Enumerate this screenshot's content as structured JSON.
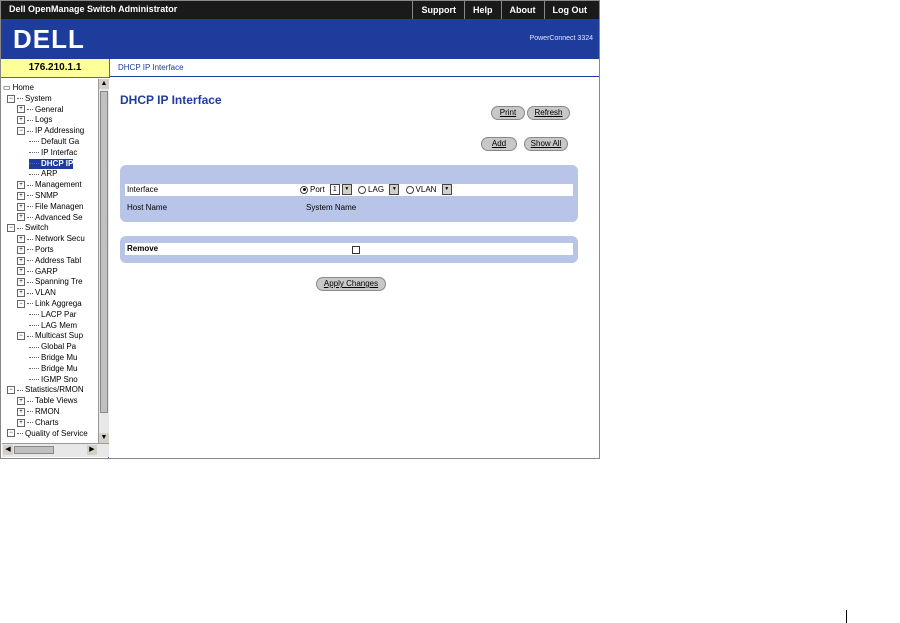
{
  "app": {
    "title": "Dell OpenManage Switch Administrator",
    "product": "PowerConnect 3324",
    "logo": "DELL"
  },
  "top_links": [
    "Support",
    "Help",
    "About",
    "Log Out"
  ],
  "ip_address": "176.210.1.1",
  "breadcrumb": "DHCP IP Interface",
  "tree": [
    {
      "label": "Home",
      "level": 0,
      "type": "home"
    },
    {
      "label": "System",
      "level": 1,
      "type": "minus"
    },
    {
      "label": "General",
      "level": 2,
      "type": "plus"
    },
    {
      "label": "Logs",
      "level": 2,
      "type": "plus"
    },
    {
      "label": "IP Addressing",
      "level": 2,
      "type": "minus"
    },
    {
      "label": "Default Ga",
      "level": 3,
      "type": "leaf"
    },
    {
      "label": "IP Interfac",
      "level": 3,
      "type": "leaf"
    },
    {
      "label": "DHCP IP",
      "level": 3,
      "type": "leaf",
      "selected": true
    },
    {
      "label": "ARP",
      "level": 3,
      "type": "leaf"
    },
    {
      "label": "Management",
      "level": 2,
      "type": "plus"
    },
    {
      "label": "SNMP",
      "level": 2,
      "type": "plus"
    },
    {
      "label": "File Managen",
      "level": 2,
      "type": "plus"
    },
    {
      "label": "Advanced Se",
      "level": 2,
      "type": "plus"
    },
    {
      "label": "Switch",
      "level": 1,
      "type": "minus"
    },
    {
      "label": "Network Secu",
      "level": 2,
      "type": "plus"
    },
    {
      "label": "Ports",
      "level": 2,
      "type": "plus"
    },
    {
      "label": "Address Tabl",
      "level": 2,
      "type": "plus"
    },
    {
      "label": "GARP",
      "level": 2,
      "type": "plus"
    },
    {
      "label": "Spanning Tre",
      "level": 2,
      "type": "plus"
    },
    {
      "label": "VLAN",
      "level": 2,
      "type": "plus"
    },
    {
      "label": "Link Aggrega",
      "level": 2,
      "type": "minus"
    },
    {
      "label": "LACP Par",
      "level": 3,
      "type": "leaf"
    },
    {
      "label": "LAG Mem",
      "level": 3,
      "type": "leaf"
    },
    {
      "label": "Multicast Sup",
      "level": 2,
      "type": "minus"
    },
    {
      "label": "Global Pa",
      "level": 3,
      "type": "leaf"
    },
    {
      "label": "Bridge Mu",
      "level": 3,
      "type": "leaf"
    },
    {
      "label": "Bridge Mu",
      "level": 3,
      "type": "leaf"
    },
    {
      "label": "IGMP Sno",
      "level": 3,
      "type": "leaf"
    },
    {
      "label": "Statistics/RMON",
      "level": 1,
      "type": "minus"
    },
    {
      "label": "Table Views",
      "level": 2,
      "type": "plus"
    },
    {
      "label": "RMON",
      "level": 2,
      "type": "plus"
    },
    {
      "label": "Charts",
      "level": 2,
      "type": "plus"
    },
    {
      "label": "Quality of Service",
      "level": 1,
      "type": "minus"
    }
  ],
  "main": {
    "title": "DHCP IP Interface",
    "buttons": {
      "print": "Print",
      "refresh": "Refresh",
      "add": "Add",
      "show_all": "Show All",
      "apply": "Apply Changes"
    },
    "form": {
      "interface_label": "Interface",
      "port_label": "Port",
      "port_value": "1",
      "lag_label": "LAG",
      "vlan_label": "VLAN",
      "host_name_label": "Host Name",
      "host_name_value": "System Name",
      "remove_label": "Remove"
    }
  }
}
